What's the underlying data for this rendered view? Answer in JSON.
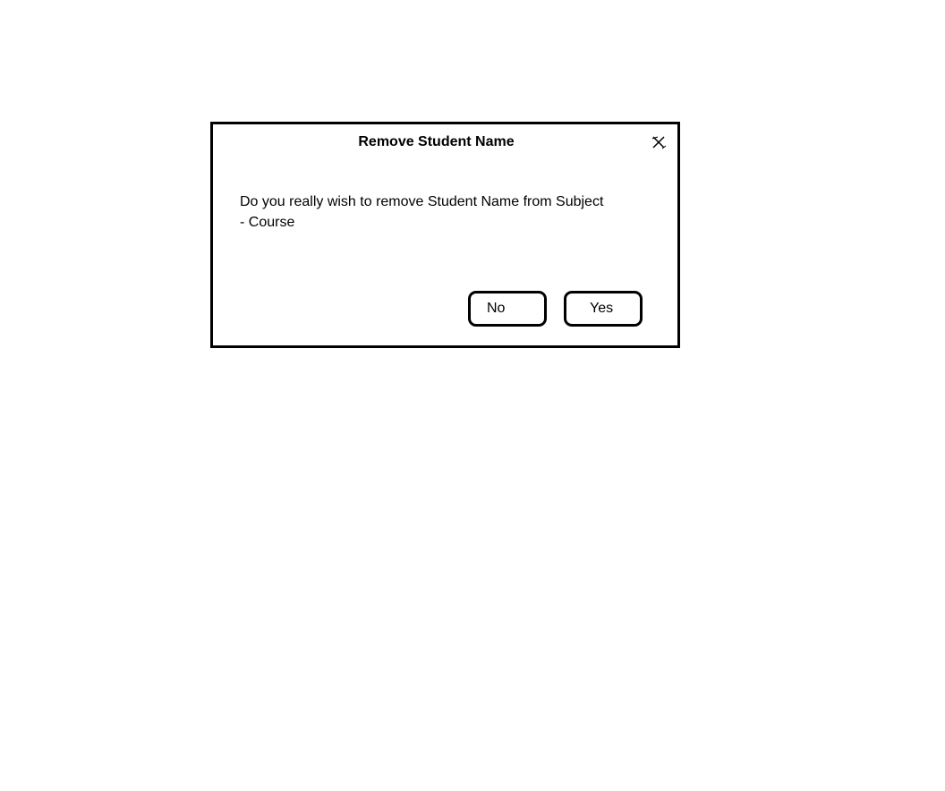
{
  "dialog": {
    "title": "Remove Student Name",
    "message_line1": "Do you really wish to remove Student Name from Subject",
    "message_line2": "- Course",
    "close_icon": "close-icon",
    "buttons": {
      "no_label": "No",
      "yes_label": "Yes"
    },
    "colors": {
      "border": "#000000",
      "background": "#ffffff",
      "text": "#000000"
    }
  }
}
